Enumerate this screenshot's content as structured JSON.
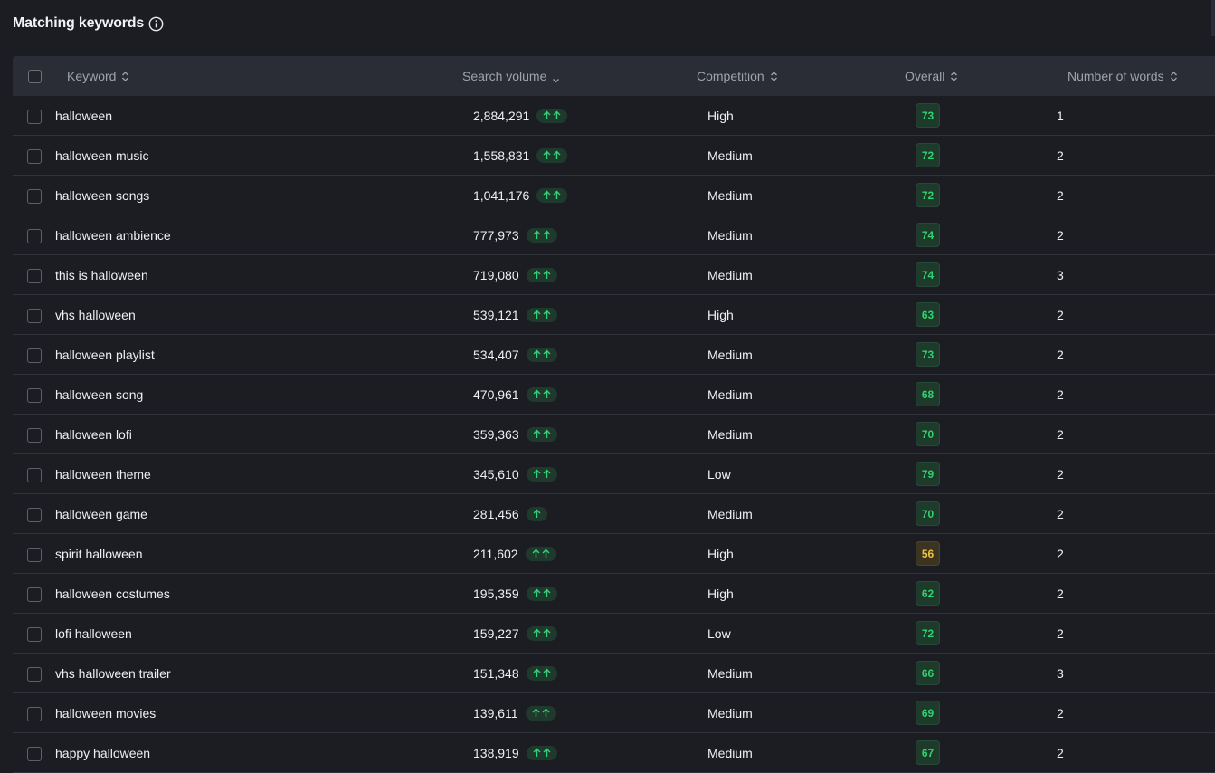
{
  "panel": {
    "title": "Matching keywords"
  },
  "columns": {
    "keyword": "Keyword",
    "search_volume": "Search volume",
    "competition": "Competition",
    "overall": "Overall",
    "words": "Number of words"
  },
  "rows": [
    {
      "keyword": "halloween",
      "volume": "2,884,291",
      "trend": 2,
      "competition": "High",
      "overall": "73",
      "words": "1",
      "tone": "good"
    },
    {
      "keyword": "halloween music",
      "volume": "1,558,831",
      "trend": 2,
      "competition": "Medium",
      "overall": "72",
      "words": "2",
      "tone": "good"
    },
    {
      "keyword": "halloween songs",
      "volume": "1,041,176",
      "trend": 2,
      "competition": "Medium",
      "overall": "72",
      "words": "2",
      "tone": "good"
    },
    {
      "keyword": "halloween ambience",
      "volume": "777,973",
      "trend": 2,
      "competition": "Medium",
      "overall": "74",
      "words": "2",
      "tone": "good"
    },
    {
      "keyword": "this is halloween",
      "volume": "719,080",
      "trend": 2,
      "competition": "Medium",
      "overall": "74",
      "words": "3",
      "tone": "good"
    },
    {
      "keyword": "vhs halloween",
      "volume": "539,121",
      "trend": 2,
      "competition": "High",
      "overall": "63",
      "words": "2",
      "tone": "good"
    },
    {
      "keyword": "halloween playlist",
      "volume": "534,407",
      "trend": 2,
      "competition": "Medium",
      "overall": "73",
      "words": "2",
      "tone": "good"
    },
    {
      "keyword": "halloween song",
      "volume": "470,961",
      "trend": 2,
      "competition": "Medium",
      "overall": "68",
      "words": "2",
      "tone": "good"
    },
    {
      "keyword": "halloween lofi",
      "volume": "359,363",
      "trend": 2,
      "competition": "Medium",
      "overall": "70",
      "words": "2",
      "tone": "good"
    },
    {
      "keyword": "halloween theme",
      "volume": "345,610",
      "trend": 2,
      "competition": "Low",
      "overall": "79",
      "words": "2",
      "tone": "good"
    },
    {
      "keyword": "halloween game",
      "volume": "281,456",
      "trend": 1,
      "competition": "Medium",
      "overall": "70",
      "words": "2",
      "tone": "good"
    },
    {
      "keyword": "spirit halloween",
      "volume": "211,602",
      "trend": 2,
      "competition": "High",
      "overall": "56",
      "words": "2",
      "tone": "mid"
    },
    {
      "keyword": "halloween costumes",
      "volume": "195,359",
      "trend": 2,
      "competition": "High",
      "overall": "62",
      "words": "2",
      "tone": "good"
    },
    {
      "keyword": "lofi halloween",
      "volume": "159,227",
      "trend": 2,
      "competition": "Low",
      "overall": "72",
      "words": "2",
      "tone": "good"
    },
    {
      "keyword": "vhs halloween trailer",
      "volume": "151,348",
      "trend": 2,
      "competition": "Medium",
      "overall": "66",
      "words": "3",
      "tone": "good"
    },
    {
      "keyword": "halloween movies",
      "volume": "139,611",
      "trend": 2,
      "competition": "Medium",
      "overall": "69",
      "words": "2",
      "tone": "good"
    },
    {
      "keyword": "happy halloween",
      "volume": "138,919",
      "trend": 2,
      "competition": "Medium",
      "overall": "67",
      "words": "2",
      "tone": "good"
    }
  ],
  "colors": {
    "background": "#1b1d23",
    "header": "#2a2d35",
    "good": "#2fd36f",
    "mid": "#f0c23a"
  }
}
